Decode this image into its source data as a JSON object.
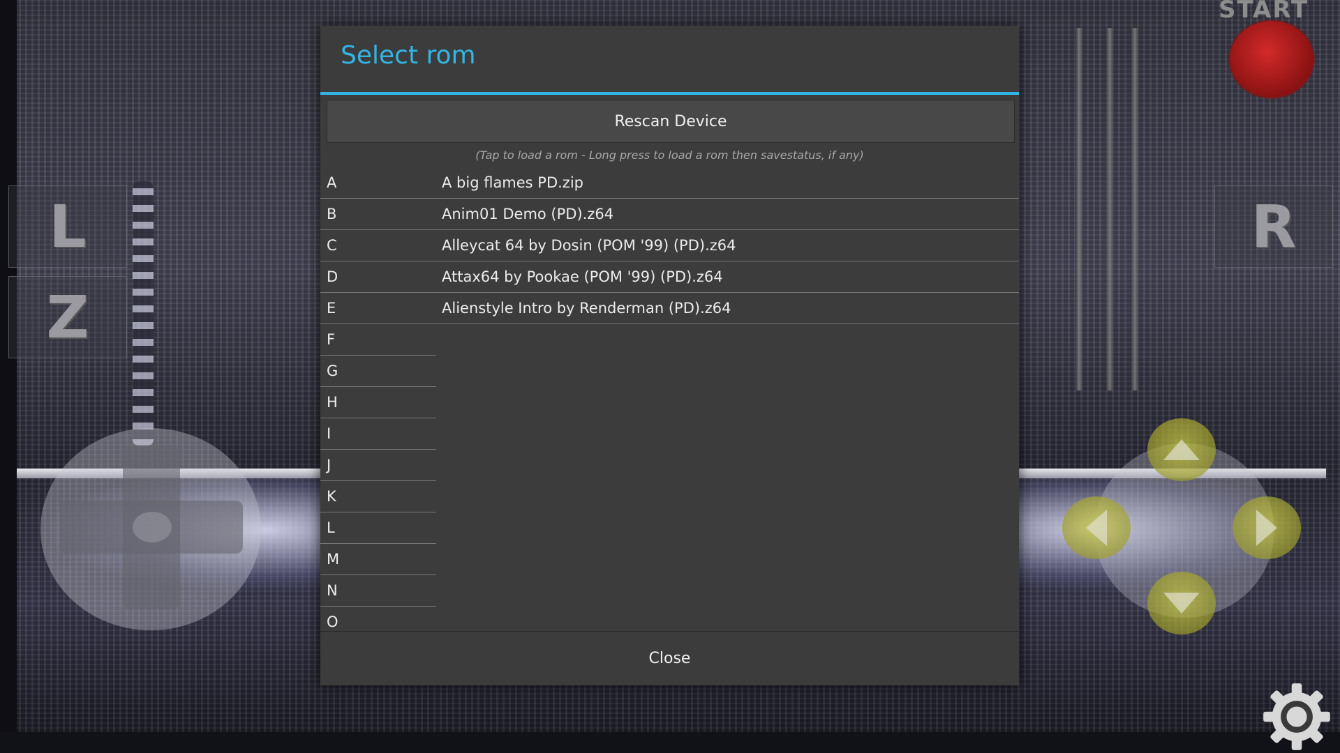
{
  "dialog": {
    "title": "Select rom",
    "rescan_label": "Rescan Device",
    "hint": "(Tap to load a rom - Long press to load a rom then savestatus, if any)",
    "close_label": "Close",
    "accent_color": "#33b5e5",
    "letters": [
      "A",
      "B",
      "C",
      "D",
      "E",
      "F",
      "G",
      "H",
      "I",
      "J",
      "K",
      "L",
      "M",
      "N",
      "O"
    ],
    "roms": [
      "A big flames PD.zip",
      "Anim01 Demo (PD).z64",
      "Alleycat 64 by Dosin (POM '99) (PD).z64",
      "Attax64 by Pookae (POM '99) (PD).z64",
      "Alienstyle Intro by Renderman (PD).z64"
    ]
  },
  "controls": {
    "start_label": "START",
    "l_label": "L",
    "z_label": "Z",
    "r_label": "R"
  }
}
